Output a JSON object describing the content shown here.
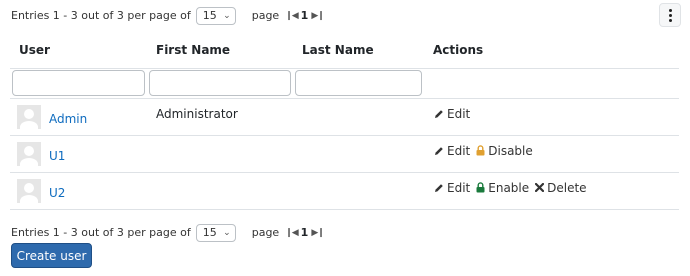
{
  "pager": {
    "summary": "Entries 1 - 3 out of 3 per page of",
    "per_page": "15",
    "page_label": "page",
    "current_page": "1"
  },
  "table": {
    "columns": [
      "User",
      "First Name",
      "Last Name",
      "Actions"
    ],
    "rows": [
      {
        "user": "Admin",
        "first_name": "Administrator",
        "last_name": "",
        "actions": [
          "Edit"
        ]
      },
      {
        "user": "U1",
        "first_name": "",
        "last_name": "",
        "actions": [
          "Edit",
          "Disable"
        ]
      },
      {
        "user": "U2",
        "first_name": "",
        "last_name": "",
        "actions": [
          "Edit",
          "Enable",
          "Delete"
        ]
      }
    ]
  },
  "icons": {
    "edit": "pencil-icon",
    "disable": "lock-open-icon",
    "enable": "lock-icon",
    "delete": "x-icon",
    "more": "kebab-icon",
    "first_page": "first-page-icon",
    "last_page": "last-page-icon"
  },
  "colors": {
    "link": "#0f6cbf",
    "primary": "#2e6aad",
    "lock_open": "#e0a030",
    "lock_closed": "#1a7a3c"
  },
  "buttons": {
    "create_user": "Create user"
  }
}
